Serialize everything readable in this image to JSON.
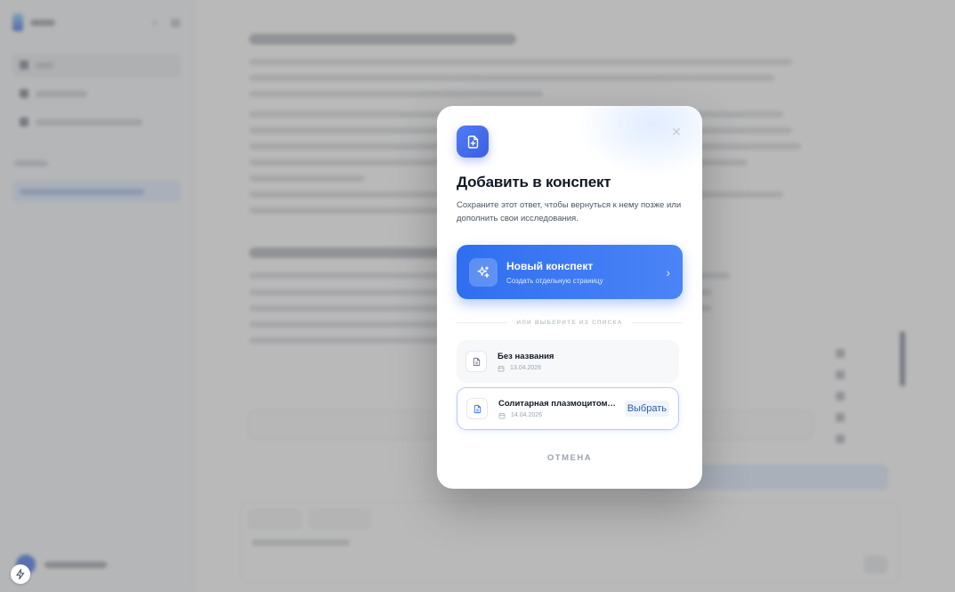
{
  "modal": {
    "title": "Добавить в конспект",
    "subtitle": "Сохраните этот ответ, чтобы вернуться к нему позже или дополнить свои исследования.",
    "close_icon": "close-icon",
    "header_icon": "document-plus-icon",
    "new_note": {
      "title": "Новый конспект",
      "subtitle": "Создать отдельную страницу",
      "icon": "sparkles-icon",
      "chevron": "chevron-right-icon"
    },
    "divider_label": "или выберите из списка",
    "notes": [
      {
        "title": "Без названия",
        "date": "13.04.2026"
      },
      {
        "title": "Солитарная плазмоцитома ...",
        "date": "14.04.2026",
        "action_label": "Выбрать"
      }
    ],
    "cancel_label": "Отмена",
    "accent_color": "#3b6ff0"
  }
}
